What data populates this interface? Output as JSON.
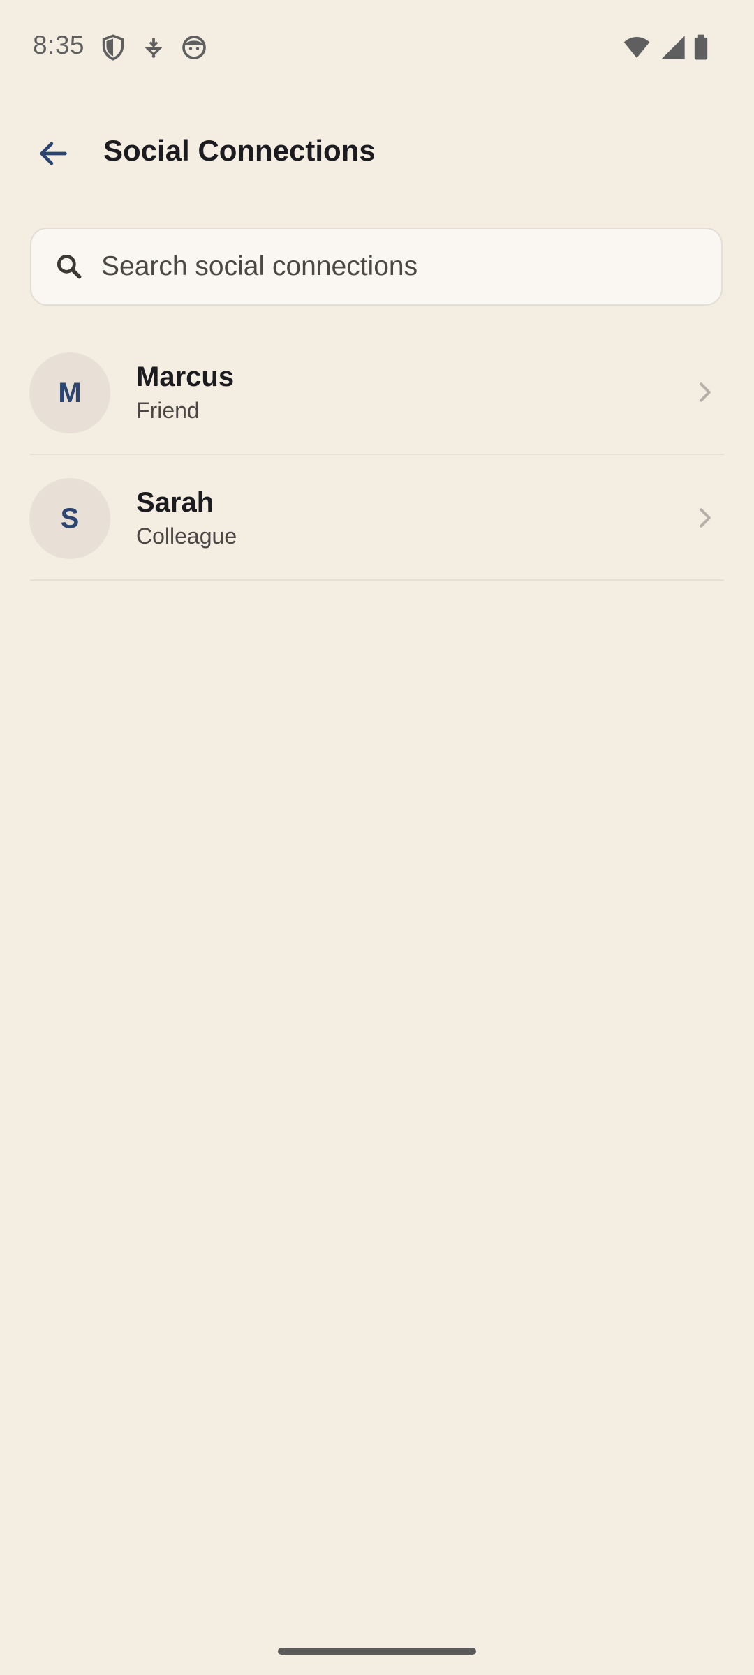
{
  "status_bar": {
    "time": "8:35",
    "icons_left": [
      "shield-icon",
      "download-icon",
      "face-icon"
    ],
    "icons_right": [
      "wifi-icon",
      "signal-icon",
      "battery-icon"
    ]
  },
  "app_bar": {
    "title": "Social Connections",
    "back_icon": "arrow-back-icon"
  },
  "search": {
    "placeholder": "Search social connections",
    "value": ""
  },
  "contacts": [
    {
      "initial": "M",
      "name": "Marcus",
      "relation": "Friend"
    },
    {
      "initial": "S",
      "name": "Sarah",
      "relation": "Colleague"
    }
  ],
  "colors": {
    "background": "#F3EDE2",
    "accent": "#2C4570",
    "avatar_bg": "#E8E0D6",
    "search_bg": "#FAF7F2"
  }
}
